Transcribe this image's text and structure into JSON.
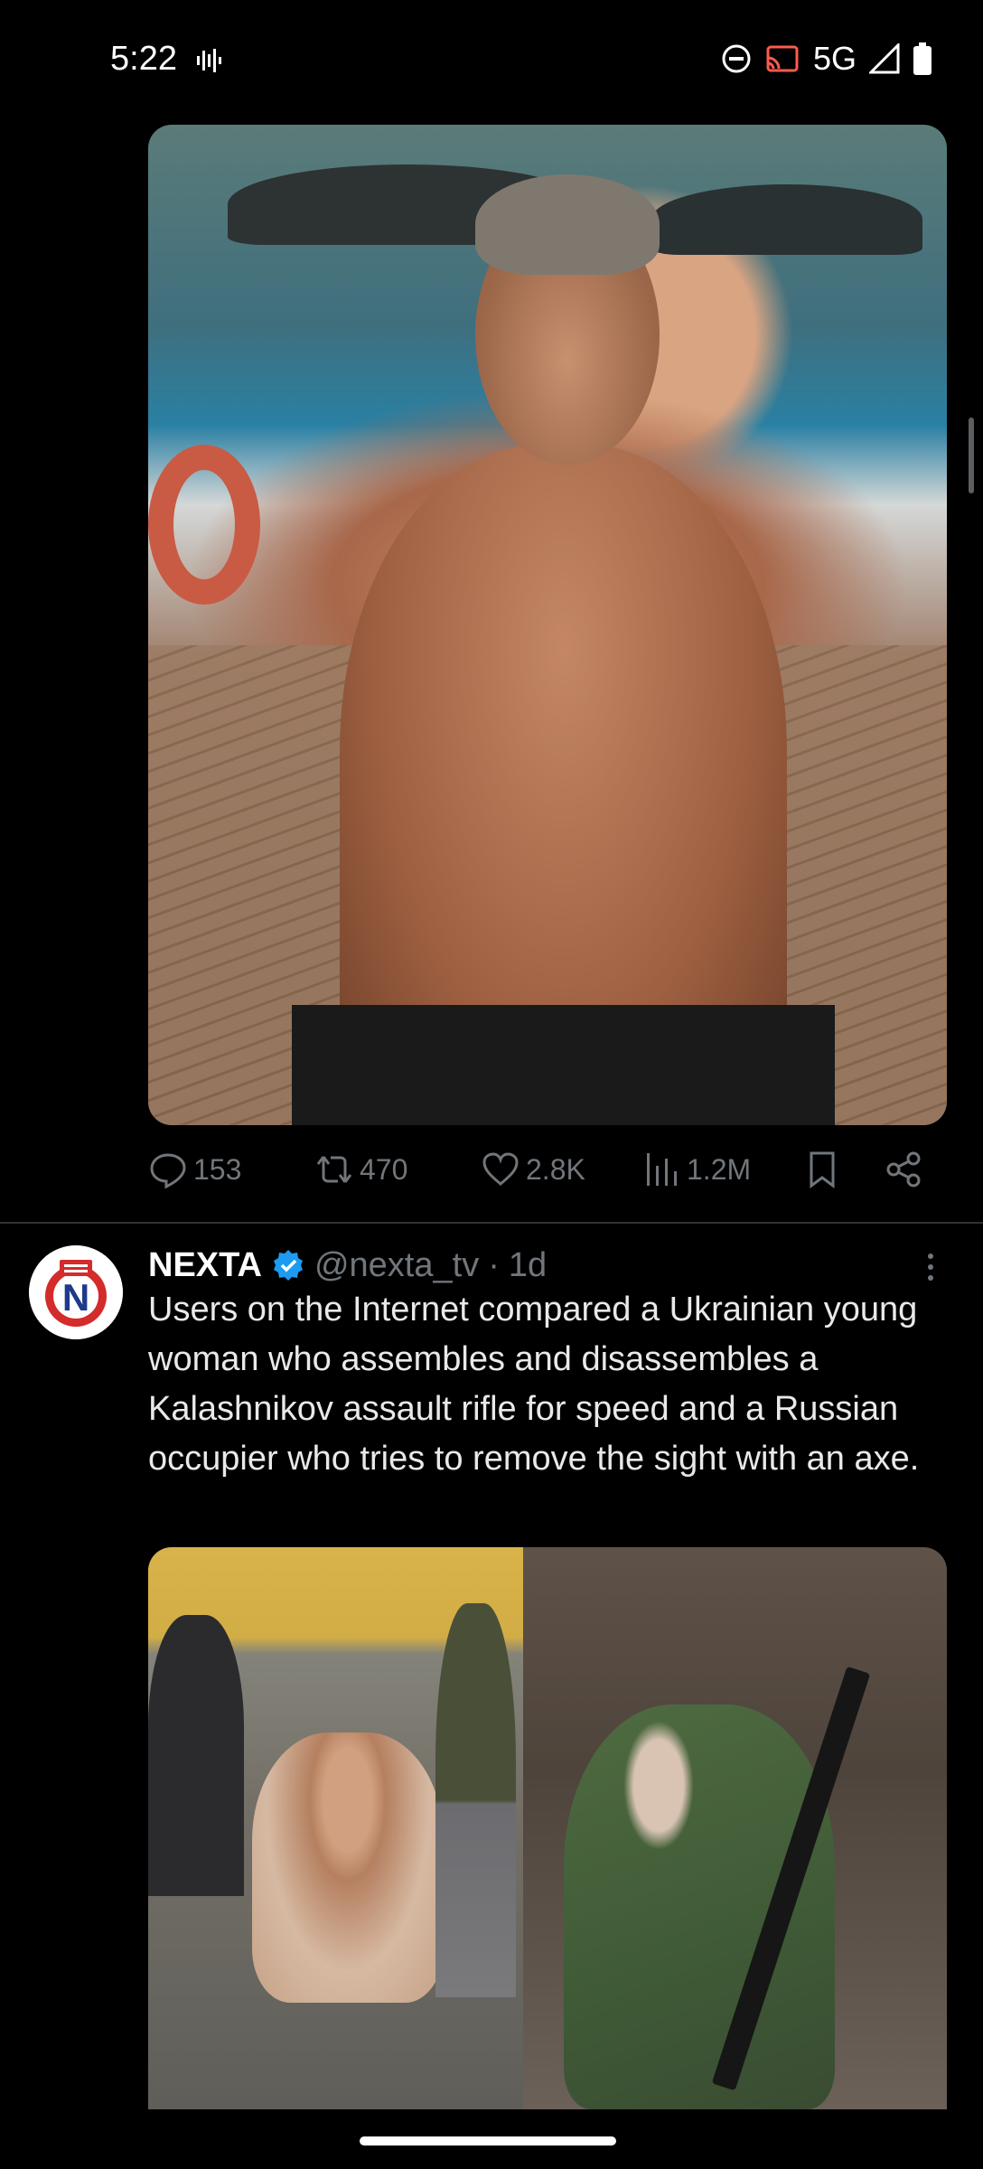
{
  "status_bar": {
    "time": "5:22",
    "network": "5G",
    "icons": [
      "waveform-icon",
      "do-not-disturb-icon",
      "cast-icon",
      "signal-icon",
      "battery-icon"
    ]
  },
  "post1": {
    "actions": {
      "replies": "153",
      "reposts": "470",
      "likes": "2.8K",
      "views": "1.2M"
    }
  },
  "post2": {
    "name": "NEXTA",
    "handle": "@nexta_tv",
    "separator": "·",
    "time": "1d",
    "text": "Users on the Internet compared a Ukrainian young woman who assembles and disassembles a Kalashnikov assault rifle for speed and a Russian occupier who tries to remove the sight with an axe.",
    "avatar_letter": "N"
  },
  "colors": {
    "background": "#000000",
    "text": "#e7e9ea",
    "muted": "#71767b",
    "verified": "#1d9bf0",
    "divider": "#2f3336"
  }
}
